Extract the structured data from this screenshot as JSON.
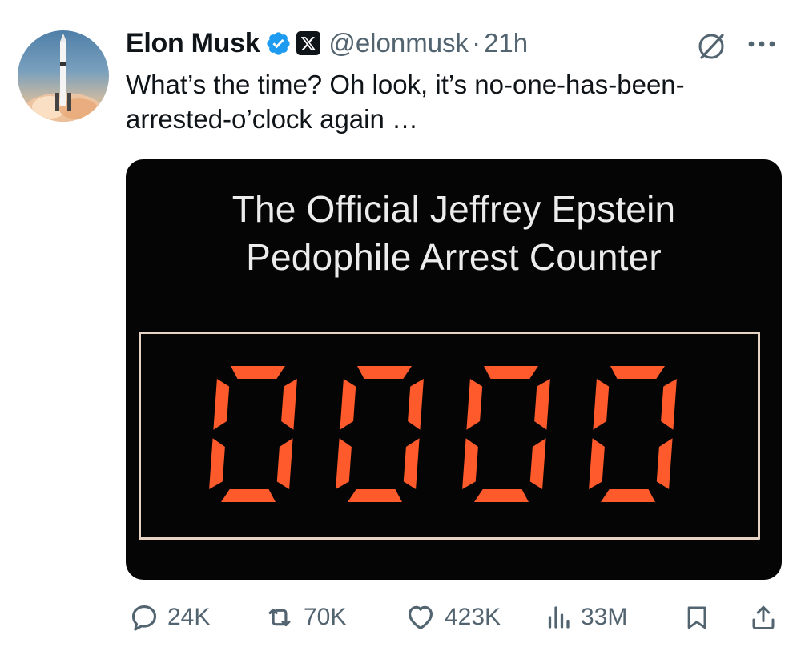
{
  "post": {
    "author_name": "Elon Musk",
    "handle": "@elonmusk",
    "separator": "·",
    "time": "21h",
    "text": "What’s the time? Oh look, it’s no-one-has-been-arrested-o’clock again …"
  },
  "media": {
    "title_line1": "The Official Jeffrey Epstein",
    "title_line2": "Pedophile Arrest Counter",
    "counter_value": "0000",
    "digit_color": "#ff5a2c"
  },
  "actions": {
    "replies": "24K",
    "reposts": "70K",
    "likes": "423K",
    "views": "33M"
  },
  "colors": {
    "verified": "#1d9bf0",
    "secondary_text": "#536471",
    "primary_text": "#0f1419"
  },
  "icons": [
    "grok-icon",
    "more-icon",
    "reply-icon",
    "repost-icon",
    "like-icon",
    "views-icon",
    "bookmark-icon",
    "share-icon",
    "verified-badge-icon",
    "x-affiliate-icon"
  ]
}
